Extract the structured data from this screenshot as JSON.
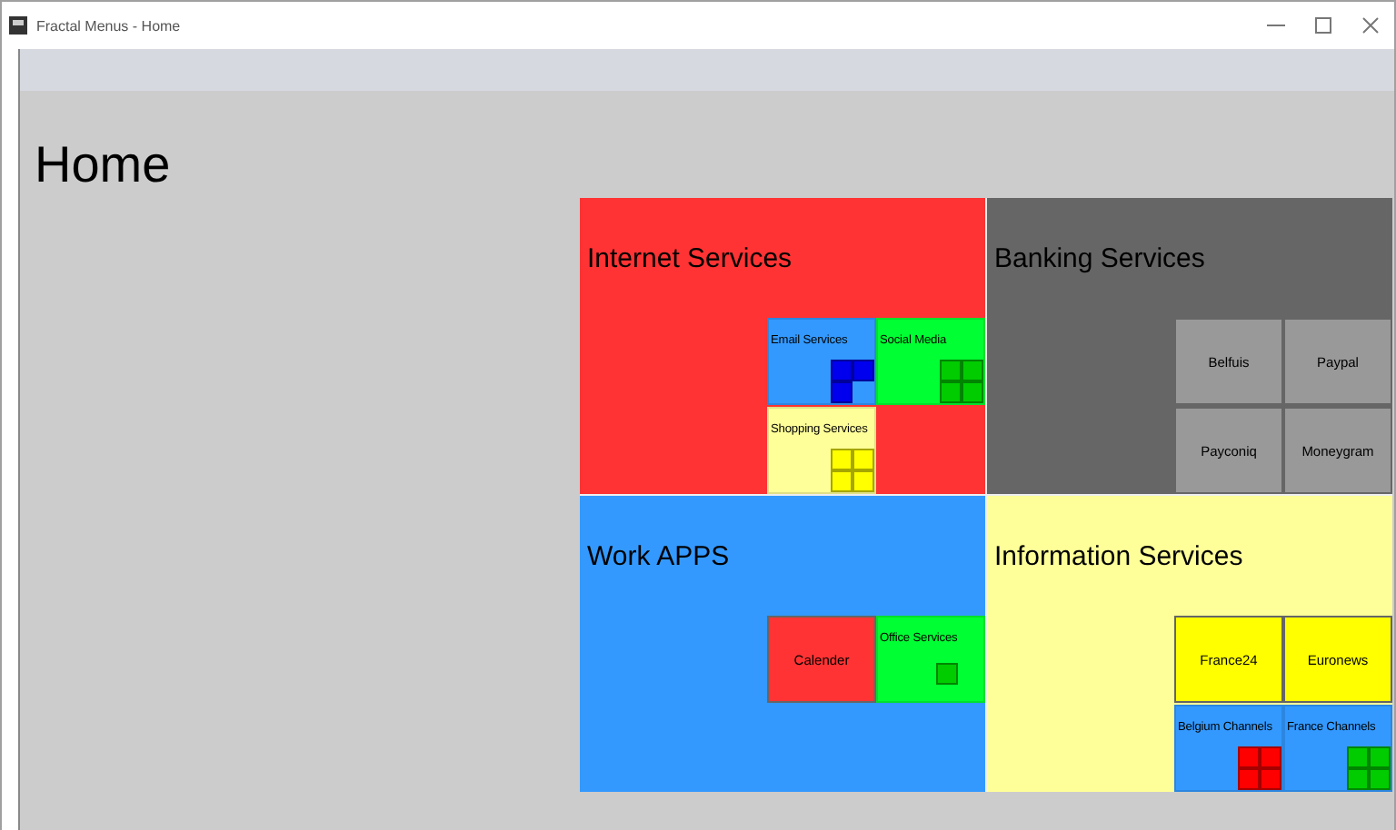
{
  "window": {
    "title": "Fractal Menus -  Home"
  },
  "page": {
    "heading": "Home"
  },
  "tiles": [
    {
      "title": "Internet Services",
      "color": "#ff3333",
      "children": [
        {
          "kind": "folder",
          "label": "Email Services",
          "color": "#3399ff",
          "mini_cells": [
            {
              "filled": true,
              "color": "#0000ee"
            },
            {
              "filled": true,
              "color": "#0000ee"
            },
            {
              "filled": true,
              "color": "#0000ee"
            },
            {
              "filled": false
            }
          ]
        },
        {
          "kind": "folder",
          "label": "Social Media",
          "color": "#00ff33",
          "mini_cells": [
            {
              "filled": true,
              "color": "#00cc00"
            },
            {
              "filled": true,
              "color": "#00cc00"
            },
            {
              "filled": true,
              "color": "#00cc00"
            },
            {
              "filled": true,
              "color": "#00cc00"
            }
          ]
        },
        {
          "kind": "folder",
          "label": "Shopping Services",
          "color": "#ffff99",
          "mini_cells": [
            {
              "filled": true,
              "color": "#ffff00"
            },
            {
              "filled": true,
              "color": "#ffff00"
            },
            {
              "filled": true,
              "color": "#ffff00"
            },
            {
              "filled": true,
              "color": "#ffff00"
            }
          ]
        }
      ]
    },
    {
      "title": "Banking Services",
      "color": "#666666",
      "children": [
        {
          "kind": "leaf",
          "label": "Belfuis",
          "color": "#999999"
        },
        {
          "kind": "leaf",
          "label": "Paypal",
          "color": "#999999"
        },
        {
          "kind": "leaf",
          "label": "Payconiq",
          "color": "#999999"
        },
        {
          "kind": "leaf",
          "label": "Moneygram",
          "color": "#999999"
        }
      ]
    },
    {
      "title": "Work APPS",
      "color": "#3399ff",
      "children": [
        {
          "kind": "leaf",
          "label": "Calender",
          "color": "#ff3333"
        },
        {
          "kind": "folder",
          "label": "Office Services",
          "color": "#00ff33",
          "mini_cells": [
            {
              "filled": true,
              "color": "#00cc00"
            }
          ]
        }
      ]
    },
    {
      "title": "Information Services",
      "color": "#ffff99",
      "children": [
        {
          "kind": "leaf",
          "label": "France24",
          "color": "#ffff00"
        },
        {
          "kind": "leaf",
          "label": "Euronews",
          "color": "#ffff00"
        },
        {
          "kind": "folder",
          "label": "Belgium Channels",
          "color": "#3399ff",
          "mini_cells": [
            {
              "filled": true,
              "color": "#ff0000"
            },
            {
              "filled": true,
              "color": "#ff0000"
            },
            {
              "filled": true,
              "color": "#ff0000"
            },
            {
              "filled": true,
              "color": "#ff0000"
            }
          ]
        },
        {
          "kind": "folder",
          "label": "France Channels",
          "color": "#3399ff",
          "mini_cells": [
            {
              "filled": true,
              "color": "#00cc00"
            },
            {
              "filled": true,
              "color": "#00cc00"
            },
            {
              "filled": true,
              "color": "#00cc00"
            },
            {
              "filled": true,
              "color": "#00cc00"
            }
          ]
        }
      ]
    }
  ]
}
